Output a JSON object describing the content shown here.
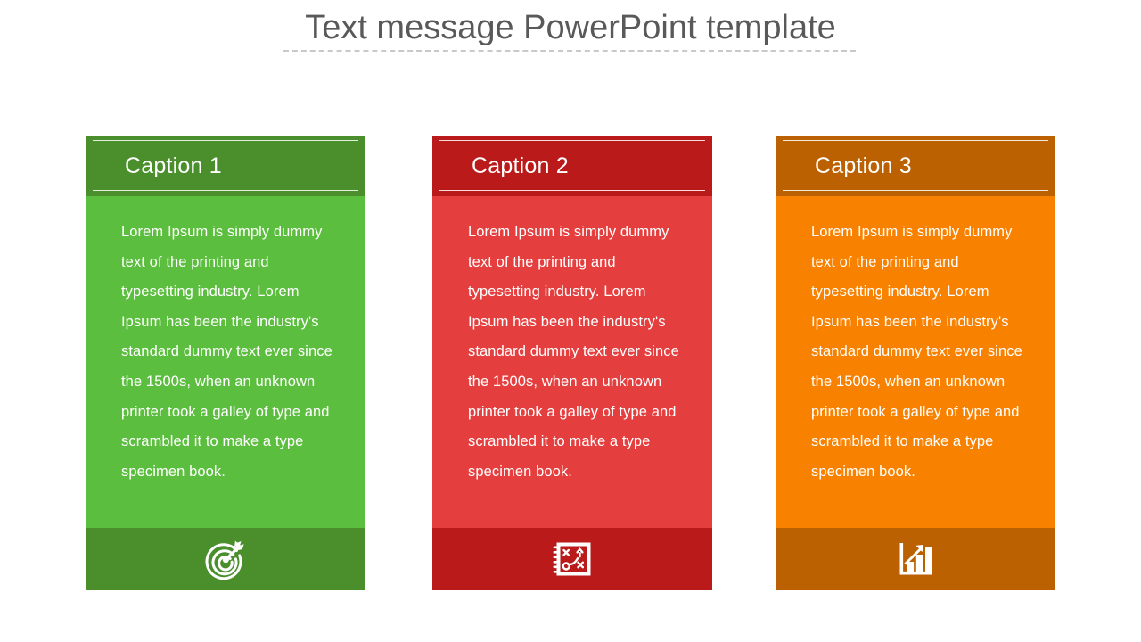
{
  "slide": {
    "title": "Text message PowerPoint template",
    "title_color": "#595959",
    "background": "#ffffff",
    "divider": "dashed-rule"
  },
  "cards": [
    {
      "caption": "Caption 1",
      "body": "Lorem Ipsum is simply dummy text of the printing and typesetting industry. Lorem Ipsum has been the industry's standard dummy text ever since the 1500s, when an unknown printer took a galley of type and scrambled it to make a type specimen book.",
      "icon": "target-arrow-icon",
      "header_color": "#4a8f2c",
      "body_color": "#5cbe3f",
      "footer_color": "#4a8f2c",
      "text_color": "#ffffff"
    },
    {
      "caption": "Caption 2",
      "body": "Lorem Ipsum is simply dummy text of the printing and typesetting industry. Lorem Ipsum has been the industry's standard dummy text ever since the 1500s, when an unknown printer took a galley of type and scrambled it to make a type specimen book.",
      "icon": "strategy-playbook-icon",
      "header_color": "#ba1a1a",
      "body_color": "#e53e3e",
      "footer_color": "#ba1a1a",
      "text_color": "#ffffff"
    },
    {
      "caption": "Caption 3",
      "body": "Lorem Ipsum is simply dummy text of the printing and typesetting industry. Lorem Ipsum has been the industry's standard dummy text ever since the 1500s, when an unknown printer took a galley of type and scrambled it to make a type specimen book.",
      "icon": "growth-bar-chart-icon",
      "header_color": "#bc6102",
      "body_color": "#f98100",
      "footer_color": "#bc6102",
      "text_color": "#ffffff"
    }
  ]
}
